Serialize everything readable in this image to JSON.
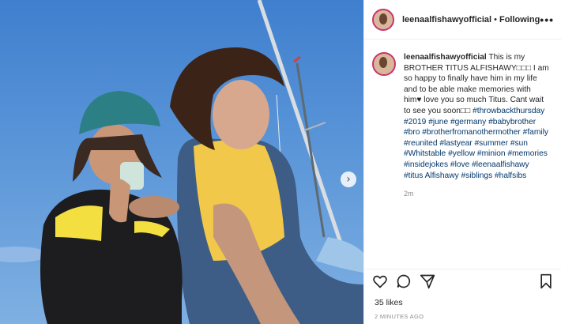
{
  "post": {
    "username": "leenaalfishawyofficial",
    "separator": "•",
    "follow_status": "Following",
    "more_label": "•••",
    "caption": {
      "username": "leenaalfishawyofficial",
      "text": " This is my BROTHER TITUS ALFISHAWY□□□ I am so happy to finally have him in my life and to be able make memories with him♥ love you so much Titus. Cant wait to see you soon□□ ",
      "hashtags": [
        "#throwbackthursday",
        "#2019",
        "#june",
        "#germany",
        "#babybrother",
        "#bro",
        "#brotherfromanothermother",
        "#family",
        "#reunited",
        "#lastyear",
        "#summer",
        "#sun",
        "#Whitstable",
        "#yellow",
        "#minion",
        "#memories",
        "#insidejokes",
        "#love",
        "#leenaalfishawy",
        "#titus",
        "Alfishawy",
        "#siblings",
        "#halfsibs"
      ],
      "time": "2m"
    },
    "likes": "35 likes",
    "posted_ago": "2 MINUTES AGO",
    "next_arrow": "›"
  },
  "icons": {
    "like": "heart-icon",
    "comment": "comment-icon",
    "share": "paper-plane-icon",
    "save": "bookmark-icon"
  },
  "colors": {
    "link": "#00376b",
    "text": "#262626",
    "muted": "#8e8e8e",
    "sky": "#4a86d2"
  }
}
